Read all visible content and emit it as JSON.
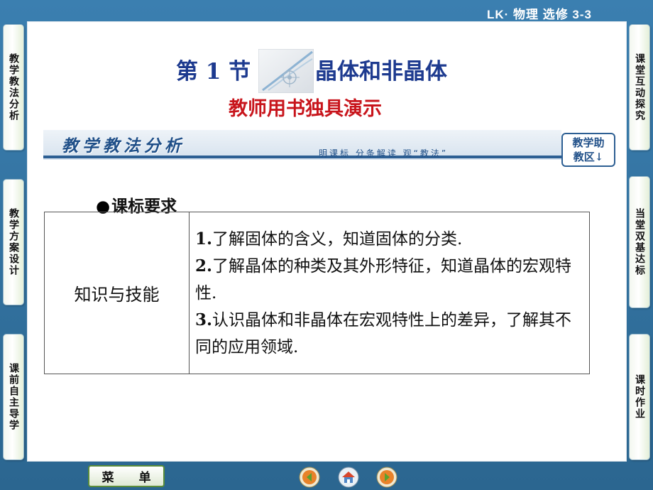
{
  "header": {
    "course_label": "LK· 物理  选修  3-3"
  },
  "left_nav": [
    {
      "label": "教学教法分析"
    },
    {
      "label": "教学方案设计"
    },
    {
      "label": "课前自主导学"
    }
  ],
  "right_nav": [
    {
      "label": "课堂互动探究"
    },
    {
      "label": "当堂双基达标"
    },
    {
      "label": "课时作业"
    }
  ],
  "title": {
    "prefix": "第 1 节",
    "main": "晶体和非晶体",
    "subtitle": "教师用书独具演示"
  },
  "banner": {
    "title": "教学教法分析",
    "tagline": "明课标  分条解读  观“教法”",
    "helper_line1": "教学助",
    "helper_line2": "教区↓"
  },
  "section": {
    "bullet": "●",
    "heading": "课标要求"
  },
  "requirements": {
    "category": "知识与技能",
    "items": [
      {
        "num": "1.",
        "text": "了解固体的含义，知道固体的分类."
      },
      {
        "num": "2.",
        "text": "了解晶体的种类及其外形特征，知道晶体的宏观特性."
      },
      {
        "num": "3.",
        "text": "认识晶体和非晶体在宏观特性上的差异，了解其不同的应用领域."
      }
    ]
  },
  "footer": {
    "menu_char1": "菜",
    "menu_char2": "单",
    "nav_icons": [
      "prev-icon",
      "home-icon",
      "next-icon"
    ]
  },
  "colors": {
    "frame": "#2f6e9c",
    "title_blue": "#1d3a8f",
    "subtitle_red": "#c8151c",
    "banner_blue": "#1f4f88"
  }
}
